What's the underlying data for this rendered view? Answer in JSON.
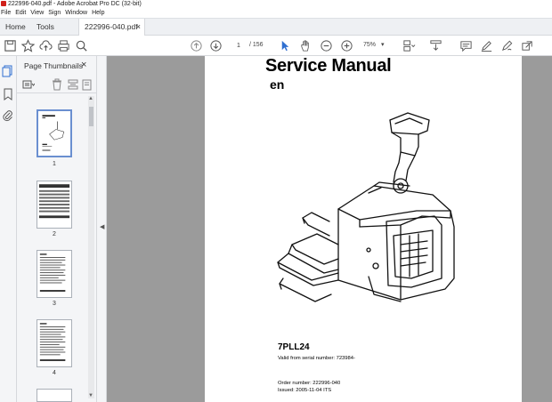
{
  "window": {
    "title": "222996-040.pdf - Adobe Acrobat Pro DC (32-bit)"
  },
  "menu": {
    "items": [
      "File",
      "Edit",
      "View",
      "Sign",
      "Window",
      "Help"
    ]
  },
  "tabs": {
    "home": "Home",
    "tools": "Tools",
    "document": "222996-040.pdf",
    "close": "×"
  },
  "toolbar": {
    "page_current": "1",
    "page_total": "/ 156",
    "zoom": "75%",
    "zoom_caret": "▾"
  },
  "thumbnails": {
    "header": "Page Thumbnails",
    "close": "×",
    "pages": [
      "1",
      "2",
      "3",
      "4"
    ]
  },
  "document": {
    "title": "Service Manual",
    "language": "en",
    "model": "7PLL24",
    "serial": "Valid from serial number: 723984-",
    "order": "Order number: 222996-040",
    "issued": "Issued: 2005-11-04 ITS"
  },
  "colors": {
    "accent": "#2f6fd0",
    "viewer_bg": "#9b9b9b",
    "app_icon": "#d0201a"
  }
}
